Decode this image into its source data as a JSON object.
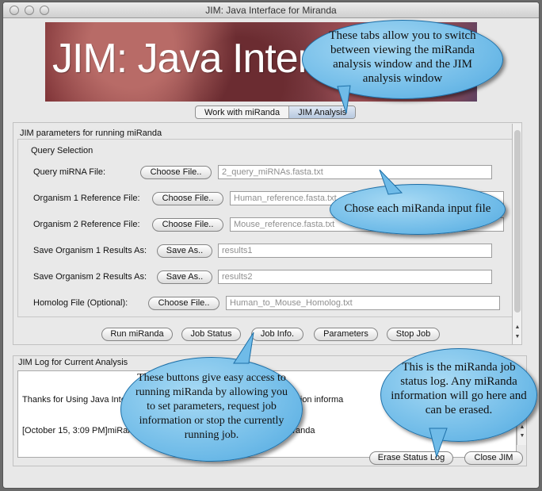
{
  "window": {
    "title": "JIM: Java Interface for Miranda"
  },
  "banner": {
    "text": "JIM: Java Interface"
  },
  "tabs": [
    {
      "label": "Work with miRanda",
      "selected": false
    },
    {
      "label": "JIM Analysis",
      "selected": true
    }
  ],
  "params": {
    "group_title": "JIM parameters for running miRanda",
    "query_title": "Query Selection",
    "rows": [
      {
        "label": "Query miRNA File:",
        "button": "Choose File..",
        "value": "2_query_miRNAs.fasta.txt"
      },
      {
        "label": "Organism 1 Reference File:",
        "button": "Choose File..",
        "value": "Human_reference.fasta.txt"
      },
      {
        "label": "Organism 2 Reference File:",
        "button": "Choose File..",
        "value": "Mouse_reference.fasta.txt"
      },
      {
        "label": "Save Organism 1 Results As:",
        "button": "Save As..",
        "value": "results1"
      },
      {
        "label": "Save Organism 2 Results As:",
        "button": "Save As..",
        "value": "results2"
      },
      {
        "label": "Homolog File (Optional):",
        "button": "Choose File..",
        "value": "Human_to_Mouse_Homolog.txt"
      }
    ]
  },
  "actions": {
    "run": "Run miRanda",
    "status": "Job Status",
    "info": "Job Info.",
    "parameters": "Parameters",
    "stop": "Stop Job"
  },
  "log": {
    "title": "JIM Log for Current Analysis",
    "line1": "Thanks for Using Java Interface",
    "line1_right": "tus, and action informa",
    "line2": "[October 15, 3:09 PM]miRand",
    "line2_right": "/src/miranda"
  },
  "bottom_buttons": {
    "erase": "Erase Status Log",
    "close": "Close JIM"
  },
  "callouts": {
    "tabs": "These tabs allow you to switch between viewing the miRanda analysis window and the JIM analysis window",
    "input": "Chose each miRanda input file",
    "buttons": "These buttons give easy access to running miRanda by allowing you to set parameters, request job information or stop the currently running job.",
    "log": "This is the miRanda job status log. Any miRanda information will go here and can be erased."
  },
  "colors": {
    "callout": "#6fbbe8",
    "tab_selected": "#b7c9df",
    "window": "#e8e8e8"
  }
}
